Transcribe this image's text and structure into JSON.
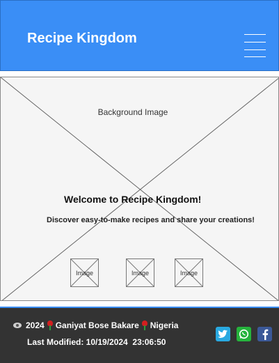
{
  "header": {
    "brand": "Recipe Kingdom",
    "menu_icon": "hamburger-menu-icon"
  },
  "hero": {
    "background_label": "Background Image",
    "title": "Welcome to Recipe Kingdom!",
    "subtitle": "Discover easy-to-make recipes and share your creations!",
    "thumbnails": [
      {
        "label": "Image"
      },
      {
        "label": "Image"
      },
      {
        "label": "Image"
      }
    ]
  },
  "footer": {
    "year": "2024",
    "author": "Ganiyat Bose Bakare",
    "country": "Nigeria",
    "last_modified_label": "Last Modified:",
    "last_modified_date": "10/19/2024",
    "last_modified_time": "23:06:50",
    "social": [
      {
        "name": "twitter-icon",
        "color": "#29a9e1"
      },
      {
        "name": "whatsapp-icon",
        "color": "#25b33c"
      },
      {
        "name": "facebook-icon",
        "color": "#3b5998"
      }
    ]
  },
  "colors": {
    "header_bg": "#3a8ef6",
    "footer_bg": "#333333",
    "placeholder_bg": "#f5f5f5"
  }
}
